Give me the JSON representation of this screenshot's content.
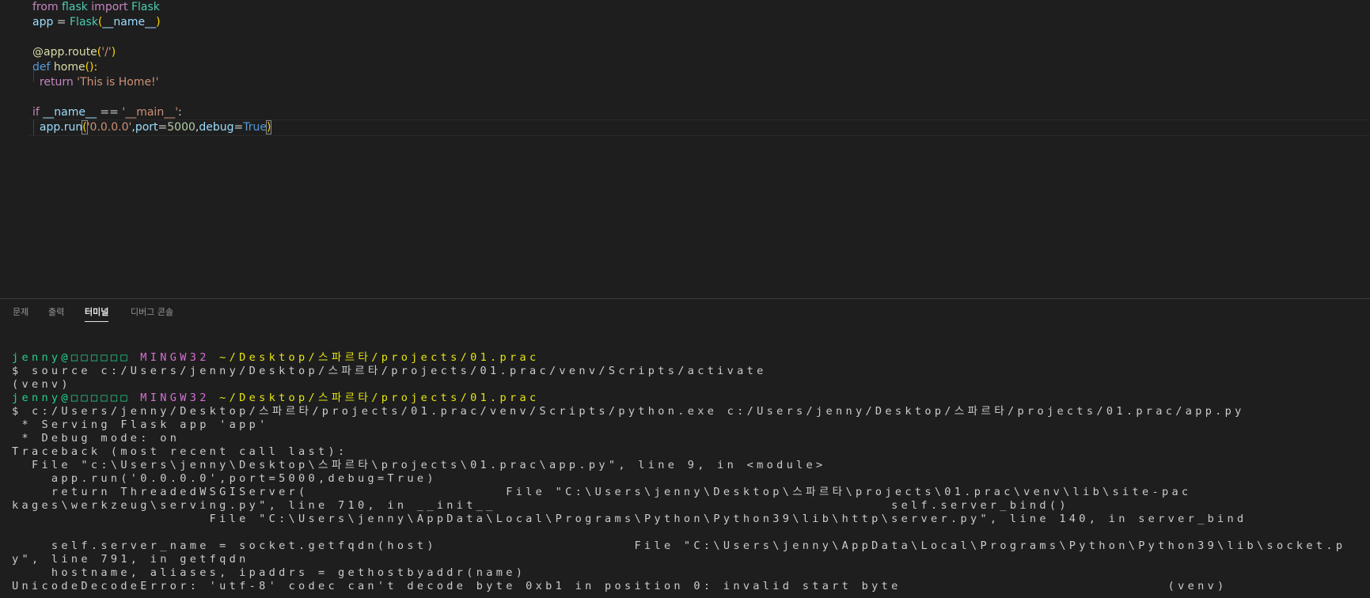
{
  "editor": {
    "lines": [
      [
        {
          "t": "from",
          "c": "kw"
        },
        {
          "t": " flask ",
          "c": "cls"
        },
        {
          "t": "import",
          "c": "kw"
        },
        {
          "t": " Flask",
          "c": "cls"
        }
      ],
      [
        {
          "t": "app",
          "c": "var"
        },
        {
          "t": " = ",
          "c": "plain"
        },
        {
          "t": "Flask",
          "c": "cls"
        },
        {
          "t": "(",
          "c": "paren"
        },
        {
          "t": "__name__",
          "c": "var"
        },
        {
          "t": ")",
          "c": "paren"
        }
      ],
      [],
      [
        {
          "t": "@app.route",
          "c": "fn"
        },
        {
          "t": "(",
          "c": "paren"
        },
        {
          "t": "'/'",
          "c": "str"
        },
        {
          "t": ")",
          "c": "paren"
        }
      ],
      [
        {
          "t": "def",
          "c": "def"
        },
        {
          "t": " home",
          "c": "fn"
        },
        {
          "t": "():",
          "c": "paren"
        }
      ],
      [
        {
          "t": "  return",
          "c": "kw"
        },
        {
          "t": " 'This is Home!'",
          "c": "str"
        }
      ],
      [],
      [
        {
          "t": "if",
          "c": "kw"
        },
        {
          "t": " __name__",
          "c": "var"
        },
        {
          "t": " == ",
          "c": "plain"
        },
        {
          "t": "'__main__'",
          "c": "str"
        },
        {
          "t": ":",
          "c": "plain"
        }
      ],
      [
        {
          "t": "  app.run",
          "c": "var"
        },
        {
          "t": "(",
          "c": "paren box"
        },
        {
          "t": "'0.0.0.0'",
          "c": "str"
        },
        {
          "t": ",",
          "c": "plain"
        },
        {
          "t": "port",
          "c": "var"
        },
        {
          "t": "=",
          "c": "plain"
        },
        {
          "t": "5000",
          "c": "num"
        },
        {
          "t": ",",
          "c": "plain"
        },
        {
          "t": "debug",
          "c": "var"
        },
        {
          "t": "=",
          "c": "plain"
        },
        {
          "t": "True",
          "c": "def"
        },
        {
          "t": ")",
          "c": "paren box"
        }
      ]
    ]
  },
  "panel": {
    "tabs": [
      "문제",
      "출력",
      "터미널",
      "디버그 콘솔"
    ],
    "active_tab": "터미널"
  },
  "terminal": {
    "lines": [
      [
        {
          "t": "jenny@□□□□□□ ",
          "c": "green"
        },
        {
          "t": "MINGW32 ",
          "c": "magenta"
        },
        {
          "t": "~/Desktop/스파르타/projects/01.prac",
          "c": "yellow"
        }
      ],
      [
        {
          "t": "$ source c:/Users/jenny/Desktop/스파르타/projects/01.prac/venv/Scripts/activate",
          "c": "white"
        }
      ],
      [
        {
          "t": "(venv)",
          "c": "white"
        }
      ],
      [
        {
          "t": "jenny@□□□□□□ ",
          "c": "green"
        },
        {
          "t": "MINGW32 ",
          "c": "magenta"
        },
        {
          "t": "~/Desktop/스파르타/projects/01.prac",
          "c": "yellow"
        }
      ],
      [
        {
          "t": "$ c:/Users/jenny/Desktop/스파르타/projects/01.prac/venv/Scripts/python.exe c:/Users/jenny/Desktop/스파르타/projects/01.prac/app.py",
          "c": "white"
        }
      ],
      [
        {
          "t": " * Serving Flask app 'app'",
          "c": "white"
        }
      ],
      [
        {
          "t": " * Debug mode: on",
          "c": "white"
        }
      ],
      [
        {
          "t": "Traceback (most recent call last):",
          "c": "white"
        }
      ],
      [
        {
          "t": "  File \"c:\\Users\\jenny\\Desktop\\스파르타\\projects\\01.prac\\app.py\", line 9, in <module>",
          "c": "white"
        }
      ],
      [
        {
          "t": "    app.run('0.0.0.0',port=5000,debug=True)",
          "c": "white"
        }
      ],
      [
        {
          "t": "    return ThreadedWSGIServer(                    File \"C:\\Users\\jenny\\Desktop\\스파르타\\projects\\01.prac\\venv\\lib\\site-pac",
          "c": "white"
        }
      ],
      [
        {
          "t": "kages\\werkzeug\\serving.py\", line 710, in __init__                                        self.server_bind()",
          "c": "white"
        }
      ],
      [
        {
          "t": "                    File \"C:\\Users\\jenny\\AppData\\Local\\Programs\\Python\\Python39\\lib\\http\\server.py\", line 140, in server_bind",
          "c": "white"
        }
      ],
      [],
      [
        {
          "t": "    self.server_name = socket.getfqdn(host)                    File \"C:\\Users\\jenny\\AppData\\Local\\Programs\\Python\\Python39\\lib\\socket.p",
          "c": "white"
        }
      ],
      [
        {
          "t": "y\", line 791, in getfqdn",
          "c": "white"
        }
      ],
      [
        {
          "t": "    hostname, aliases, ipaddrs = gethostbyaddr(name)",
          "c": "white"
        }
      ],
      [
        {
          "t": "UnicodeDecodeError: 'utf-8' codec can't decode byte 0xb1 in position 0: invalid start byte                           (venv)",
          "c": "white"
        }
      ]
    ]
  }
}
